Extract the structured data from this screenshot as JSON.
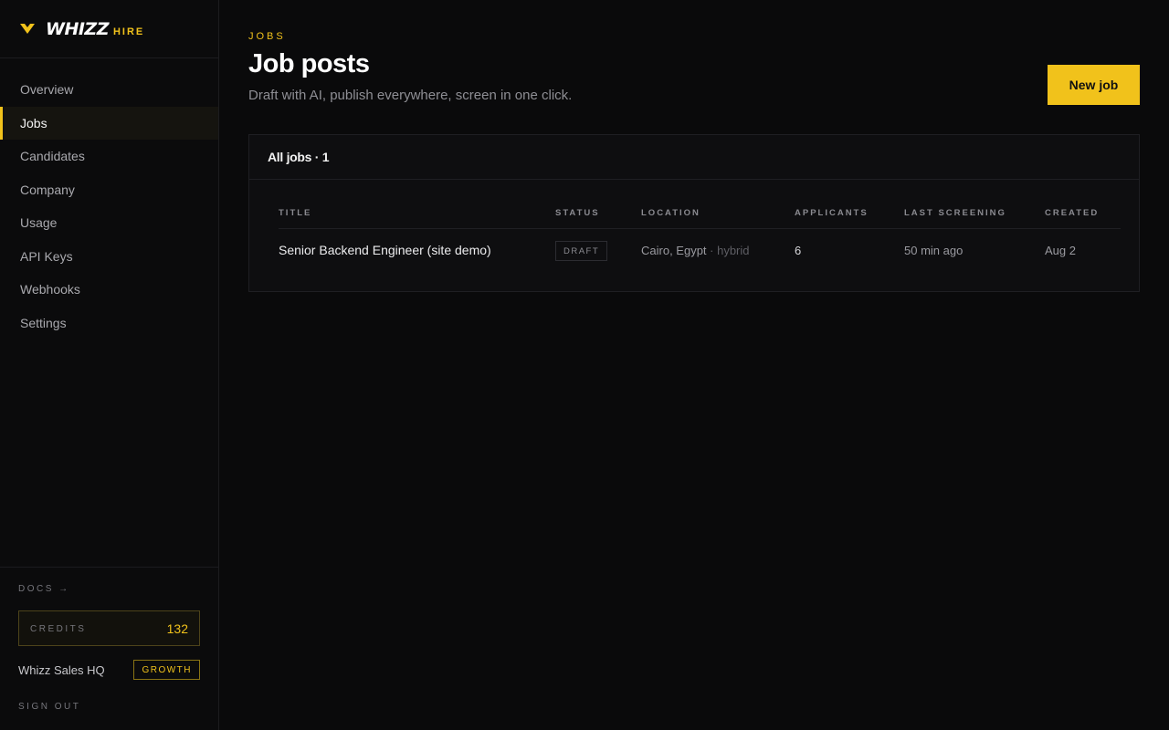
{
  "brand": {
    "name": "WHIZZ",
    "sub": "HIRE",
    "accent": "#f1c21b"
  },
  "sidebar": {
    "items": [
      {
        "label": "Overview"
      },
      {
        "label": "Jobs",
        "active": true
      },
      {
        "label": "Candidates"
      },
      {
        "label": "Company"
      },
      {
        "label": "Usage"
      },
      {
        "label": "API Keys"
      },
      {
        "label": "Webhooks"
      },
      {
        "label": "Settings"
      }
    ],
    "docs": "DOCS →",
    "credits_label": "CREDITS",
    "credits_value": "132",
    "workspace": "Whizz Sales HQ",
    "plan": "GROWTH",
    "signout": "SIGN OUT"
  },
  "header": {
    "eyebrow": "JOBS",
    "title": "Job posts",
    "subtitle": "Draft with AI, publish everywhere, screen in one click.",
    "new_job": "New job"
  },
  "panel": {
    "title": "All jobs · 1",
    "columns": [
      "TITLE",
      "STATUS",
      "LOCATION",
      "APPLICANTS",
      "LAST SCREENING",
      "CREATED"
    ],
    "rows": [
      {
        "title": "Senior Backend Engineer (site demo)",
        "status": "DRAFT",
        "location": "Cairo, Egypt",
        "mode": " · hybrid",
        "applicants": "6",
        "last_screening": "50 min ago",
        "created": "Aug 2"
      }
    ]
  }
}
